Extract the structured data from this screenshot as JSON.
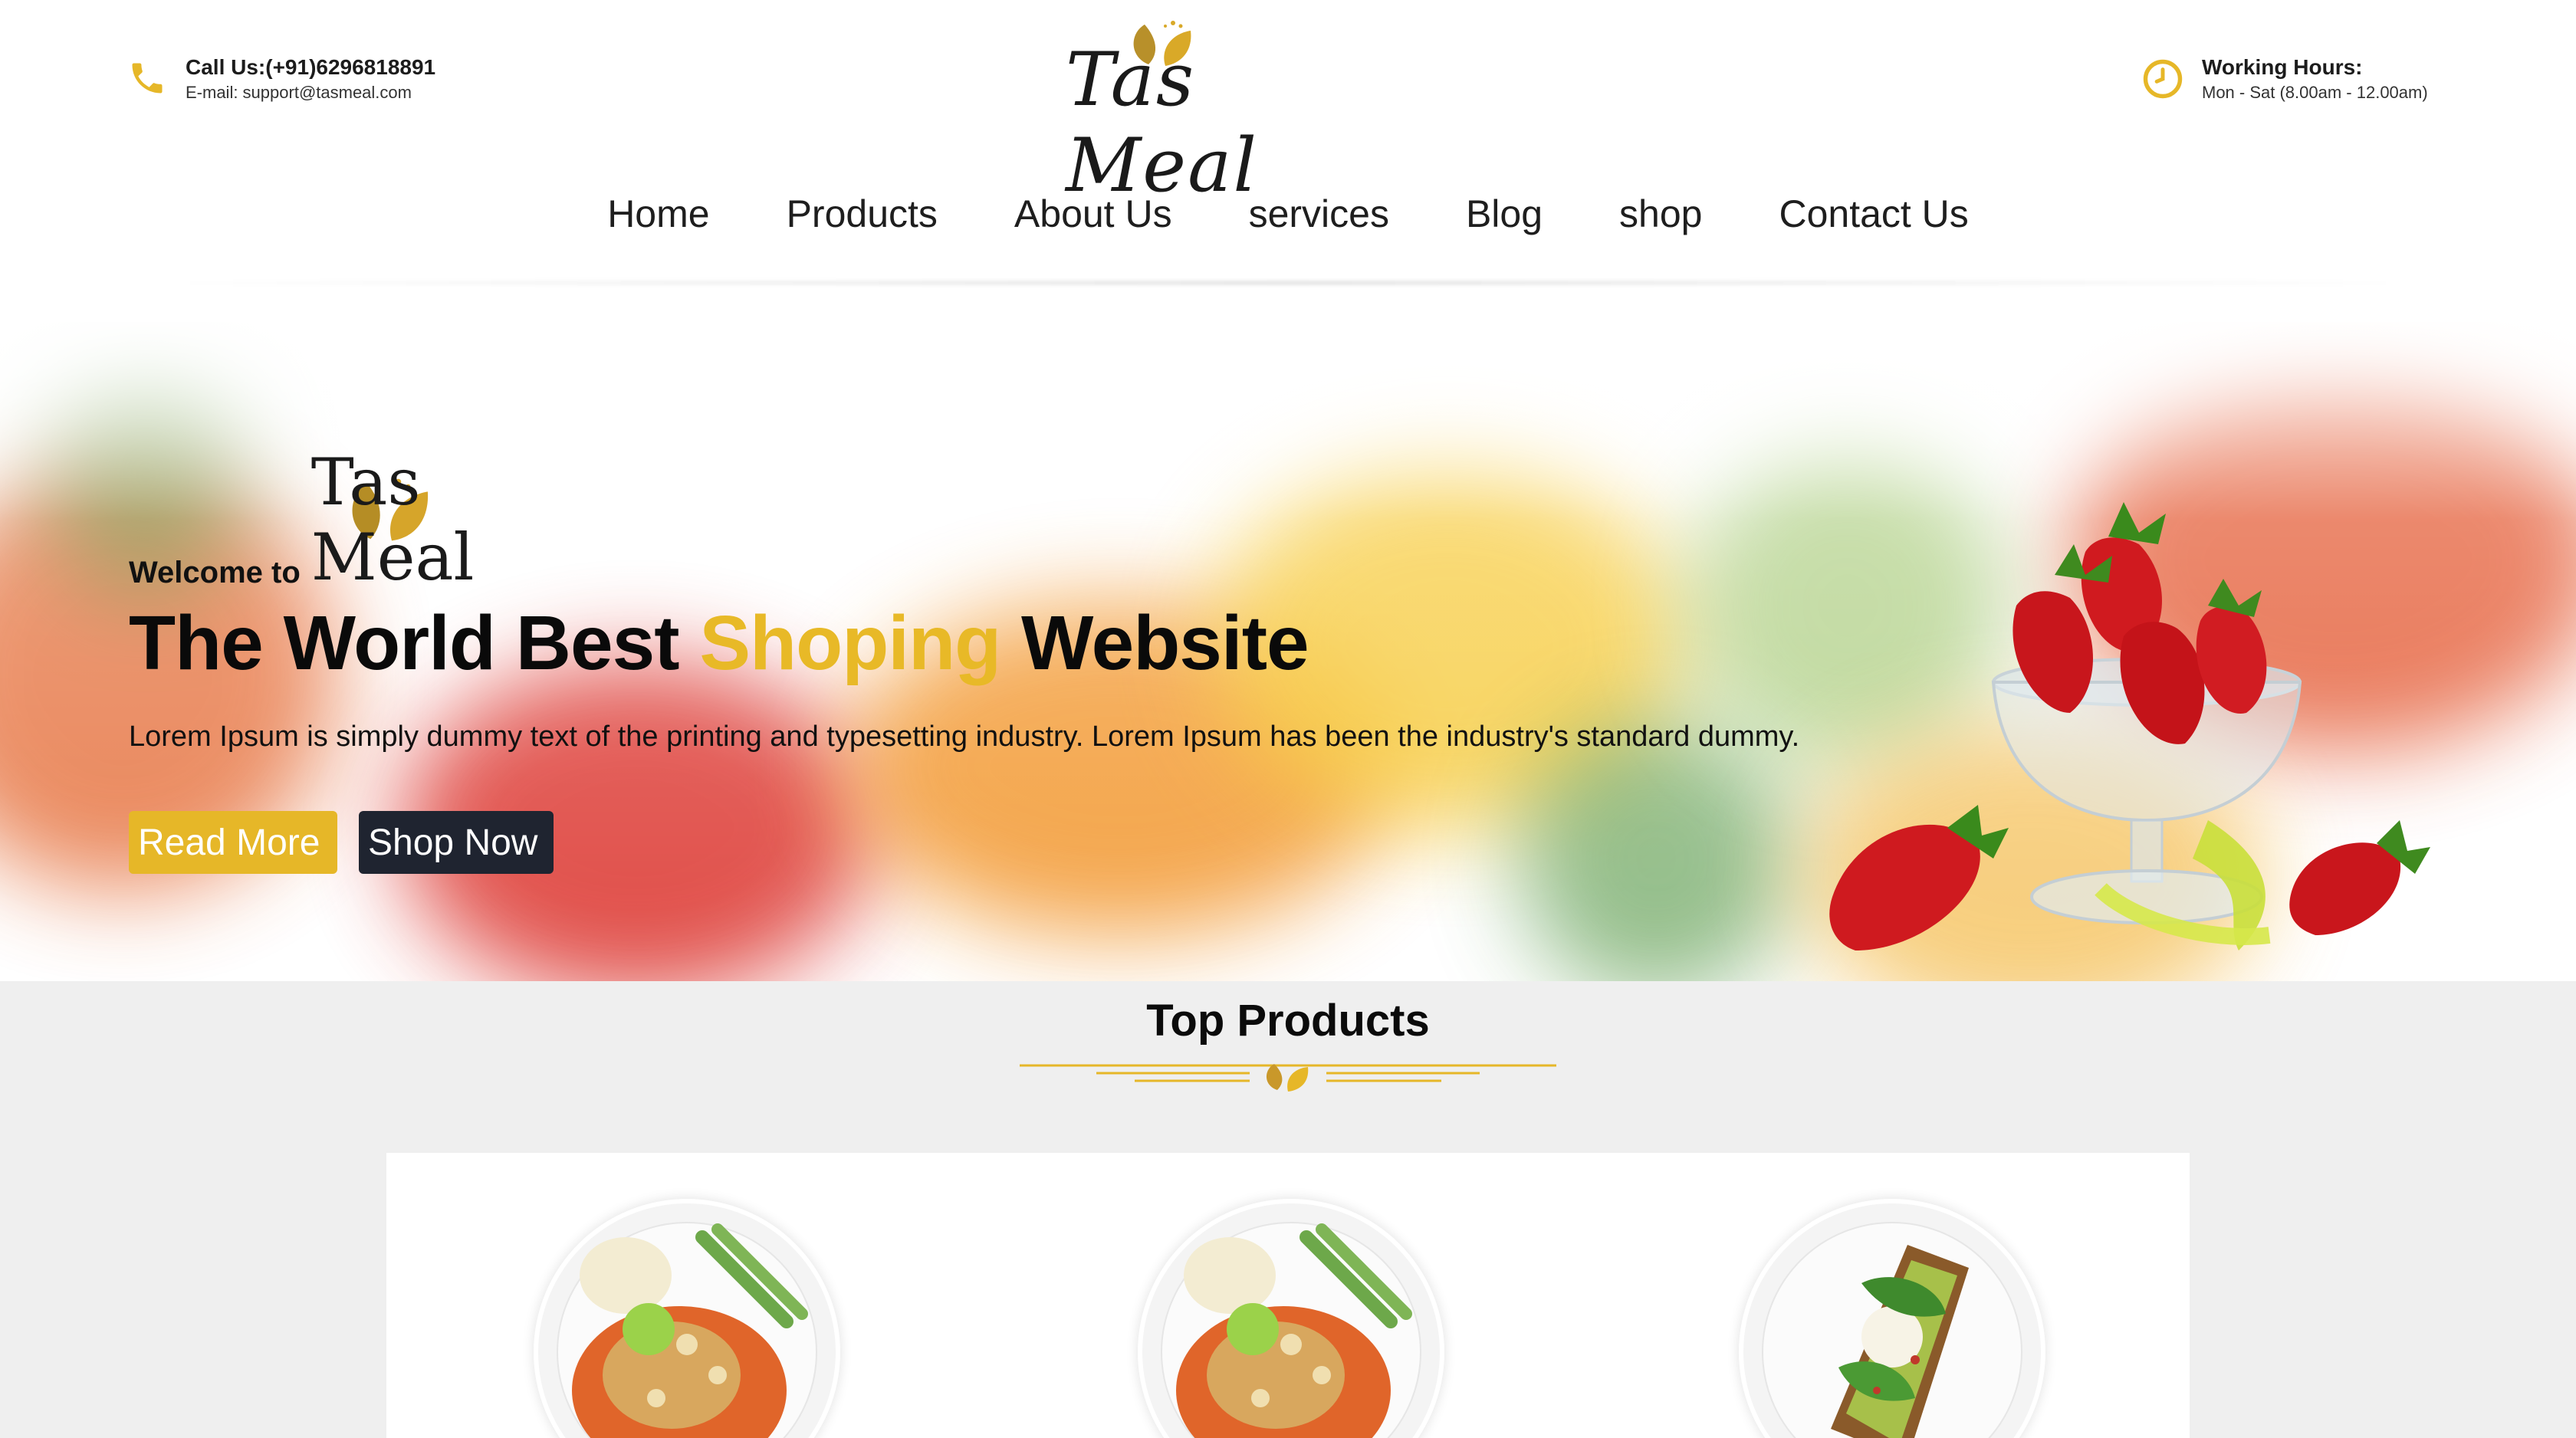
{
  "header": {
    "call": "Call Us:(+91)6296818891",
    "email": "E-mail: support@tasmeal.com",
    "logo": "Tas Meal",
    "hours_title": "Working Hours:",
    "hours_value": "Mon - Sat (8.00am - 12.00am)",
    "icons": {
      "phone": "phone-icon",
      "clock": "clock-icon"
    },
    "accent_color": "#e6b728"
  },
  "nav": {
    "items": [
      "Home",
      "Products",
      "About Us",
      "services",
      "Blog",
      "shop",
      "Contact Us"
    ]
  },
  "hero": {
    "welcome": "Welcome to",
    "brand": "Tas Meal",
    "headline_part1": "The World Best ",
    "headline_accent": "Shoping",
    "headline_part2": " Website",
    "description": "Lorem Ipsum is simply dummy text of the printing and typesetting industry. Lorem Ipsum has been the industry's standard dummy.",
    "read_more": "Read More",
    "shop_now": "Shop Now",
    "read_more_color": "#e6b728",
    "shop_now_color": "#1f2430"
  },
  "top_products": {
    "title": "Top Products"
  }
}
